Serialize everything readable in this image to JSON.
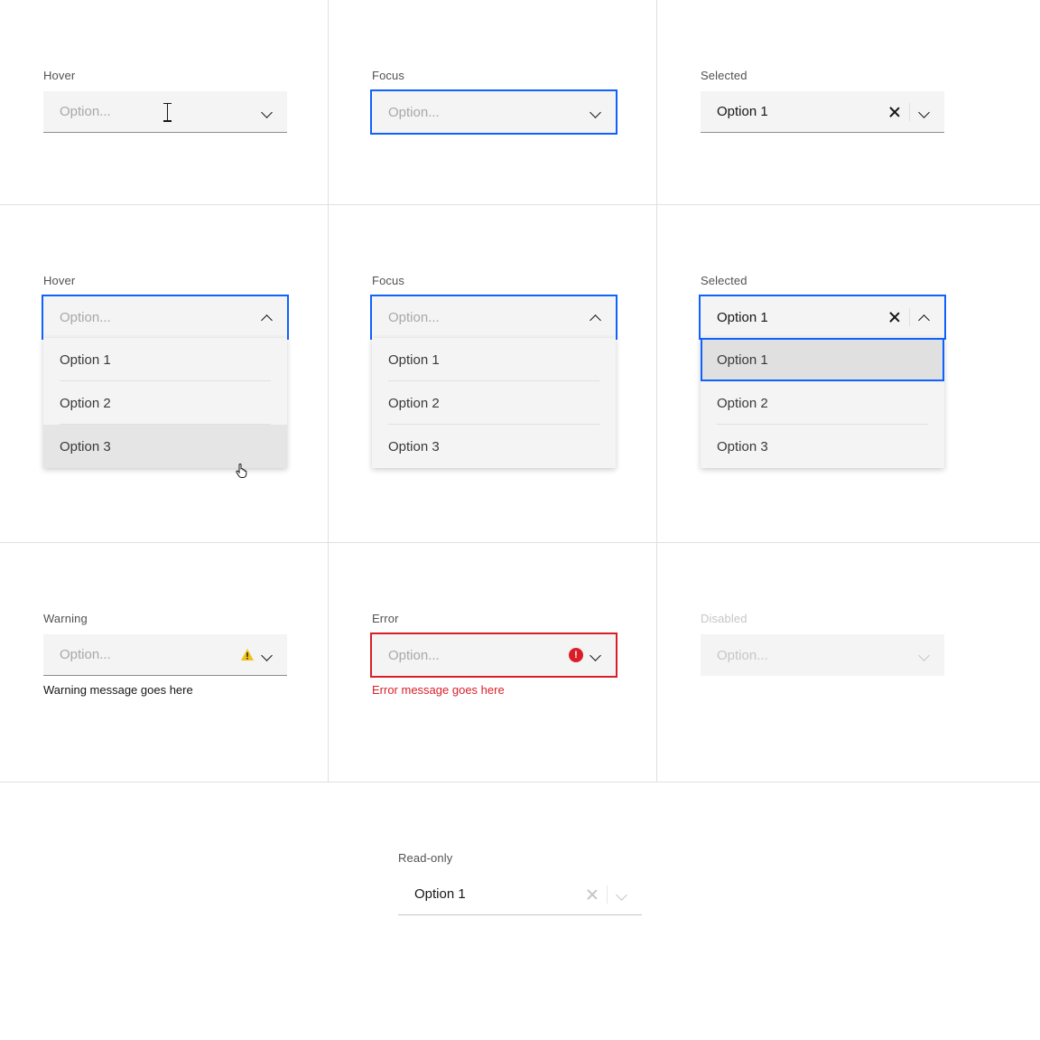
{
  "placeholder": "Option...",
  "selectedValue": "Option 1",
  "options": [
    "Option 1",
    "Option 2",
    "Option 3"
  ],
  "row1": {
    "hover": {
      "label": "Hover"
    },
    "focus": {
      "label": "Focus"
    },
    "selected": {
      "label": "Selected"
    }
  },
  "row2": {
    "hover": {
      "label": "Hover"
    },
    "focus": {
      "label": "Focus"
    },
    "selected": {
      "label": "Selected"
    }
  },
  "row3": {
    "warning": {
      "label": "Warning",
      "message": "Warning message goes here"
    },
    "error": {
      "label": "Error",
      "message": "Error message goes here"
    },
    "disabled": {
      "label": "Disabled"
    }
  },
  "row4": {
    "readonly": {
      "label": "Read-only"
    }
  }
}
